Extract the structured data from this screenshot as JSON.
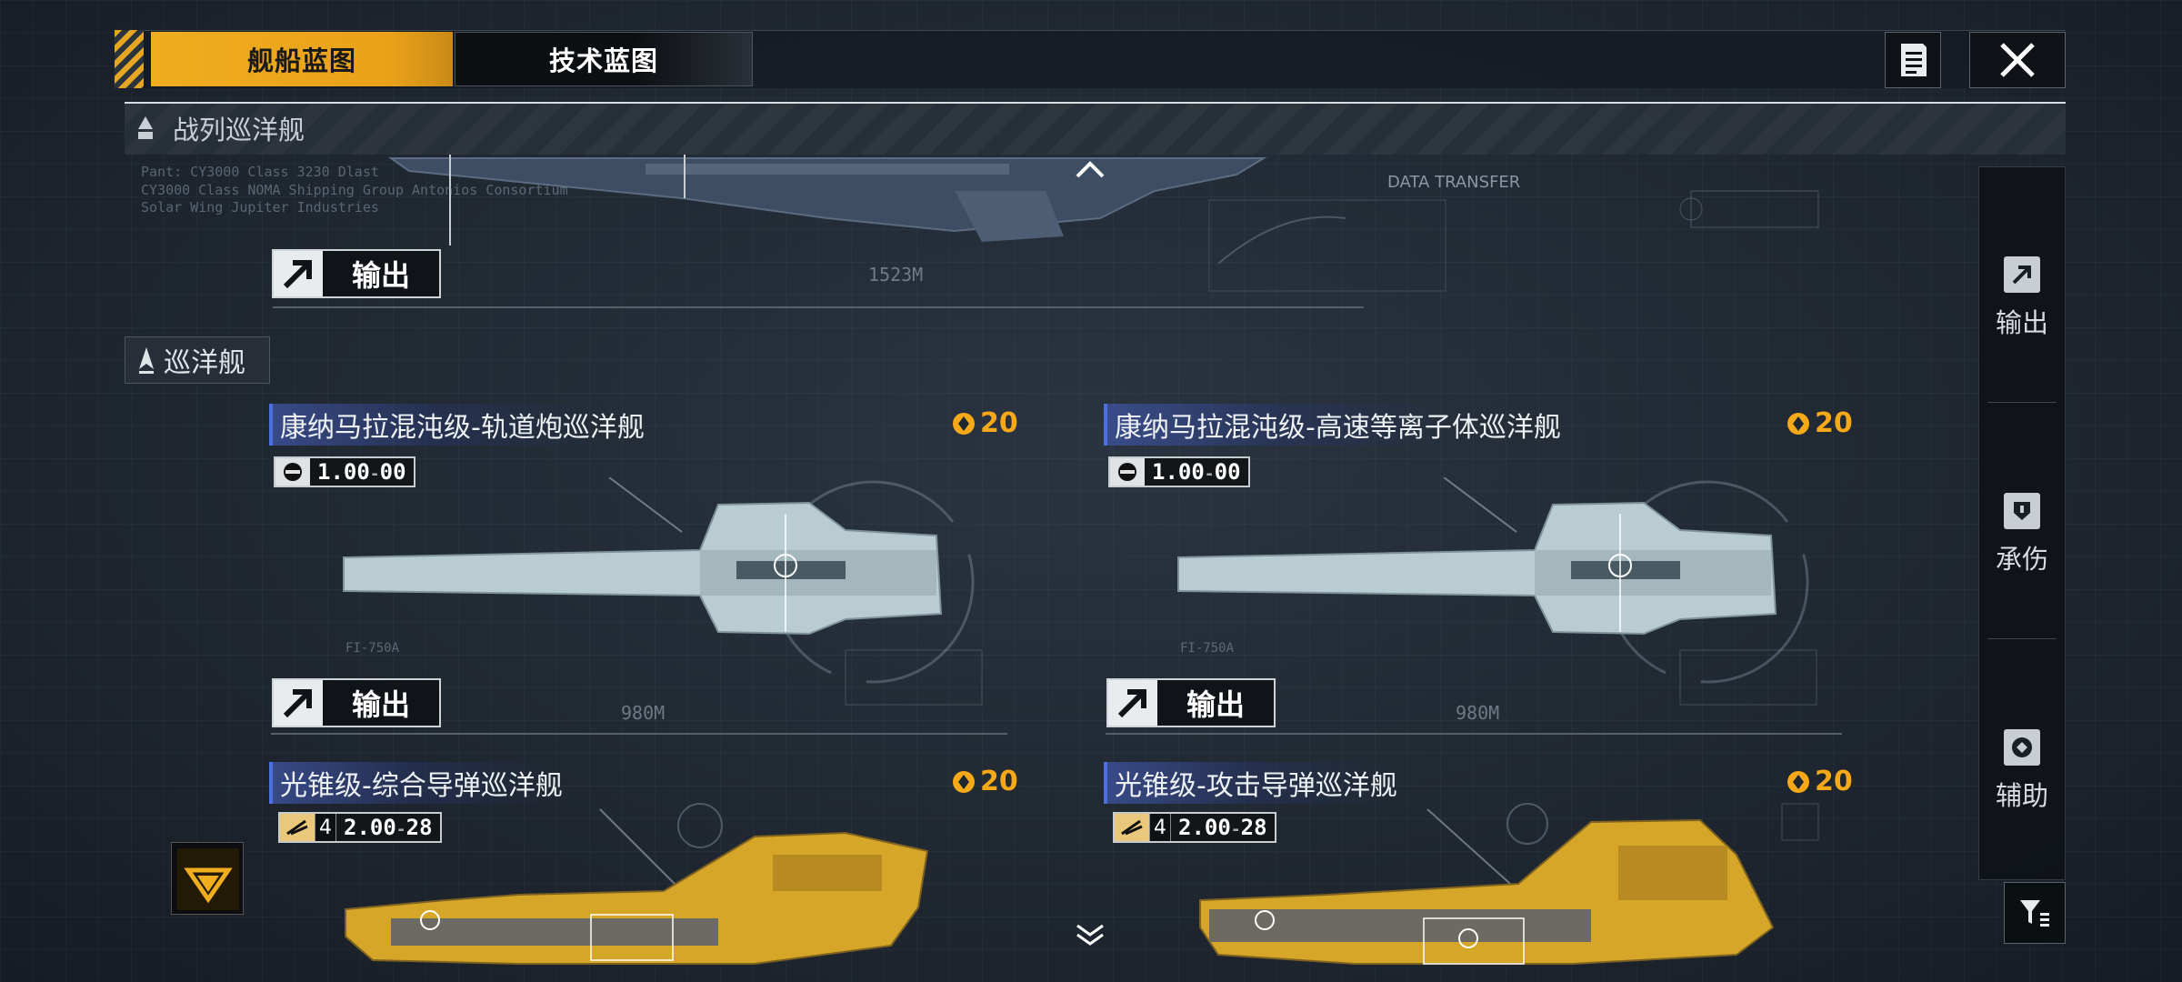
{
  "tabs": [
    {
      "label": "舰船蓝图",
      "active": true
    },
    {
      "label": "技术蓝图",
      "active": false
    }
  ],
  "section": {
    "title": "战列巡洋舰"
  },
  "top_ship": {
    "output_label": "输出",
    "length_label": "1523M",
    "data_transfer": "DATA TRANSFER",
    "caption_lines": [
      "Pant: CY3000 Class 3230 Dlast",
      "CY3000 Class NOMA Shipping Group Antonios Consortium",
      "Solar Wing Jupiter Industries"
    ]
  },
  "sub_section": {
    "title": "巡洋舰"
  },
  "cards": [
    {
      "title": "康纳马拉混沌级-轨道炮巡洋舰",
      "cost": "20",
      "badge_value": "1.00",
      "badge_suffix": "00",
      "output_label": "输出",
      "length_label": "980M",
      "weapon_code": "FI-750A"
    },
    {
      "title": "康纳马拉混沌级-高速等离子体巡洋舰",
      "cost": "20",
      "badge_value": "1.00",
      "badge_suffix": "00",
      "output_label": "输出",
      "length_label": "980M",
      "weapon_code": "FI-750A"
    },
    {
      "title": "光锥级-综合导弹巡洋舰",
      "cost": "20",
      "badge_level": "4",
      "badge_value": "2.00",
      "badge_suffix": "28"
    },
    {
      "title": "光锥级-攻击导弹巡洋舰",
      "cost": "20",
      "badge_level": "4",
      "badge_value": "2.00",
      "badge_suffix": "28"
    }
  ],
  "side_panel": {
    "items": [
      {
        "label": "输出",
        "icon": "output-icon"
      },
      {
        "label": "承伤",
        "icon": "shield-icon"
      },
      {
        "label": "辅助",
        "icon": "support-icon"
      }
    ]
  },
  "colors": {
    "accent": "#f0ad1f",
    "title_bar": "#4d6fe0",
    "background": "#1e2630"
  }
}
